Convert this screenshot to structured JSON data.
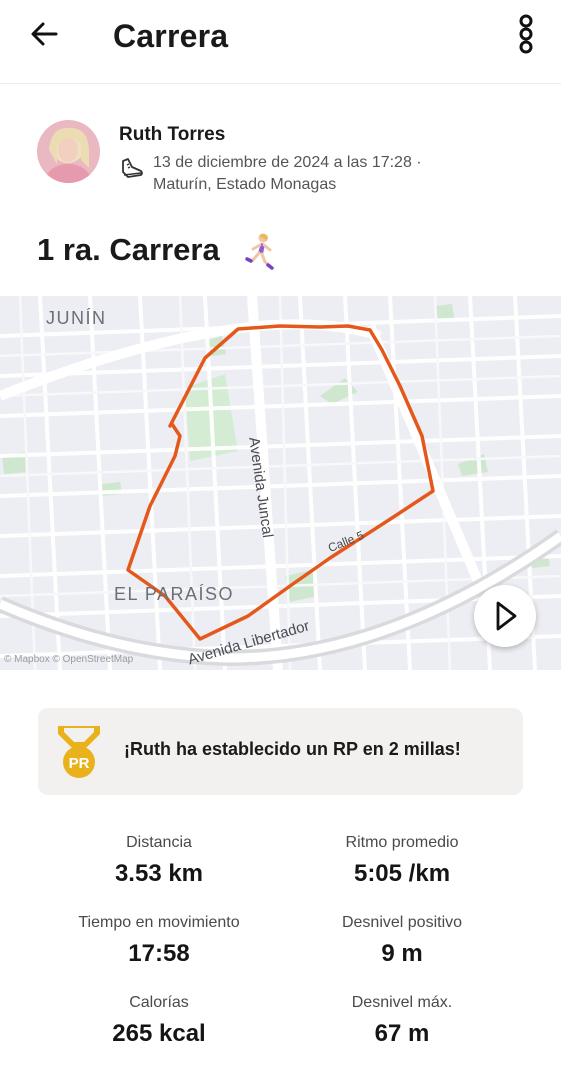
{
  "header": {
    "title": "Carrera",
    "back_icon": "arrow-left-icon",
    "more_icon": "more-vertical-icon"
  },
  "author": {
    "name": "Ruth Torres",
    "activity_icon": "running-shoe-icon",
    "meta_line1": "13 de diciembre de 2024 a las 17:28 ·",
    "meta_line2": "Maturín, Estado Monagas"
  },
  "activity": {
    "title": "1 ra. Carrera",
    "emoji": "woman-running-icon"
  },
  "map": {
    "labels": {
      "area_junin": "JUNÍN",
      "area_paraiso": "EL PARAÍSO",
      "street_juncal": "Avenida Juncal",
      "street_libertador": "Avenida Libertador",
      "street_calle": "Calle 5"
    },
    "attribution": "© Mapbox © OpenStreetMap",
    "route_color": "#e5581b",
    "play_icon": "play-icon"
  },
  "pr_banner": {
    "text": "¡Ruth ha establecido un RP en 2 millas!",
    "badge_text": "PR",
    "badge_color": "#e9b21c"
  },
  "stats": [
    {
      "label": "Distancia",
      "value": "3.53 km"
    },
    {
      "label": "Ritmo promedio",
      "value": "5:05 /km"
    },
    {
      "label": "Tiempo en movimiento",
      "value": "17:58"
    },
    {
      "label": "Desnivel positivo",
      "value": "9 m"
    },
    {
      "label": "Calorías",
      "value": "265 kcal"
    },
    {
      "label": "Desnivel máx.",
      "value": "67 m"
    }
  ]
}
